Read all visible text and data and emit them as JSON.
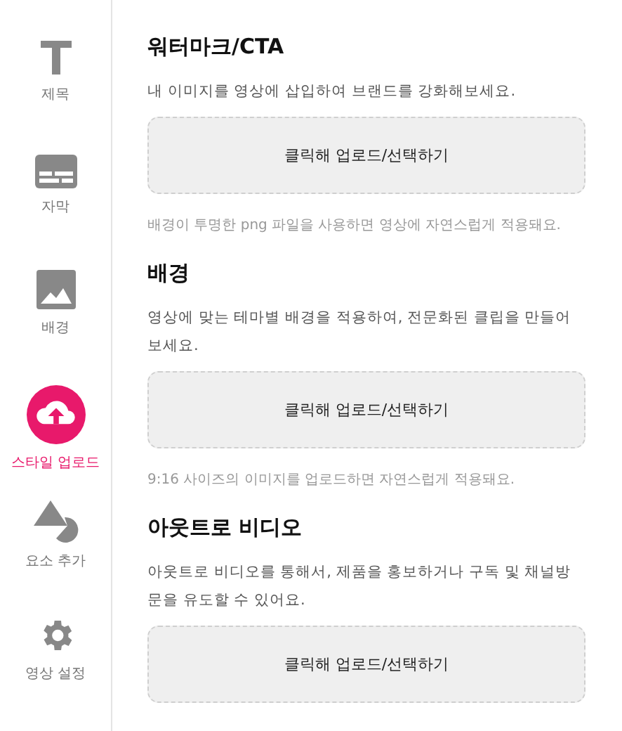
{
  "sidebar": {
    "items": [
      {
        "kind": "title",
        "label": "제목",
        "selected": false
      },
      {
        "kind": "subtitle",
        "label": "자막",
        "selected": false
      },
      {
        "kind": "background",
        "label": "배경",
        "selected": false
      },
      {
        "kind": "upload",
        "label": "스타일 업로드",
        "selected": true
      },
      {
        "kind": "shapes",
        "label": "요소 추가",
        "selected": false
      },
      {
        "kind": "settings",
        "label": "영상 설정",
        "selected": false
      }
    ]
  },
  "sections": [
    {
      "title": "워터마크/CTA",
      "description": "내 이미지를 영상에 삽입하여 브랜드를 강화해보세요.",
      "upload": "클릭해 업로드/선택하기",
      "note": "배경이 투명한 png 파일을 사용하면 영상에 자연스럽게 적용돼요."
    },
    {
      "title": "배경",
      "description": "영상에 맞는 테마별 배경을 적용하여, 전문화된 클립을 만들어보세요.",
      "upload": "클릭해 업로드/선택하기",
      "note": "9:16 사이즈의 이미지를 업로드하면 자연스럽게 적용돼요."
    },
    {
      "title": "아웃트로 비디오",
      "description": "아웃트로 비디오를 통해서, 제품을 홍보하거나 구독 및 채널방문을 유도할 수 있어요.",
      "upload": "클릭해 업로드/선택하기"
    }
  ]
}
